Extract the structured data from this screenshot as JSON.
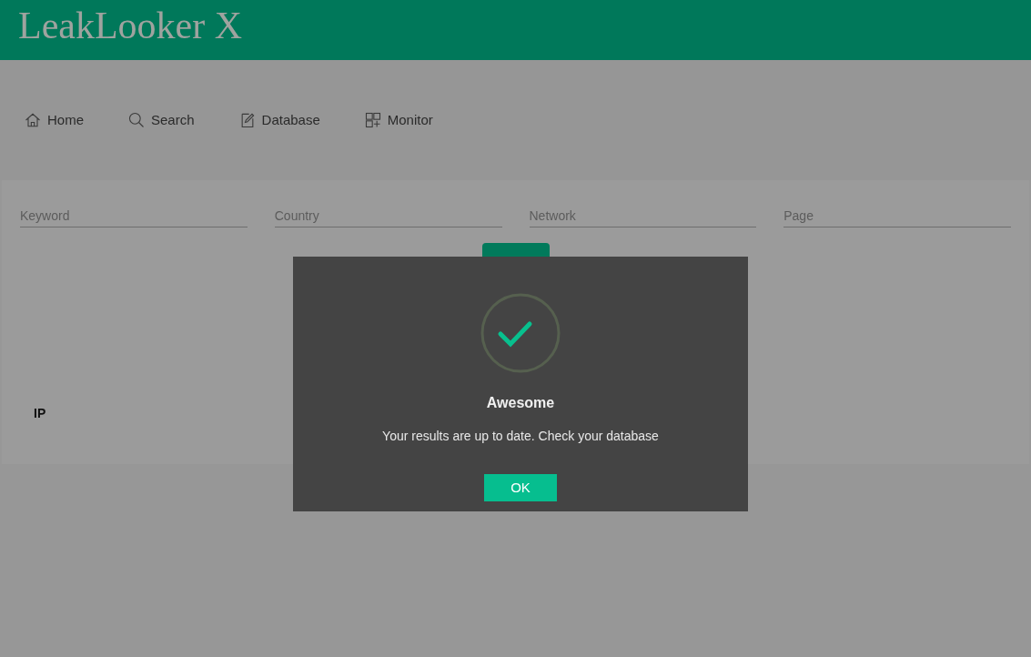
{
  "app": {
    "title": "LeakLooker X"
  },
  "nav": [
    {
      "label": "Home"
    },
    {
      "label": "Search"
    },
    {
      "label": "Database"
    },
    {
      "label": "Monitor"
    }
  ],
  "form": {
    "fields": [
      {
        "placeholder": "Keyword"
      },
      {
        "placeholder": "Country"
      },
      {
        "placeholder": "Network"
      },
      {
        "placeholder": "Page"
      }
    ]
  },
  "results": {
    "column_1": "IP"
  },
  "dialog": {
    "title": "Awesome",
    "message": "Your results are up to date. Check your database",
    "button": "OK"
  }
}
